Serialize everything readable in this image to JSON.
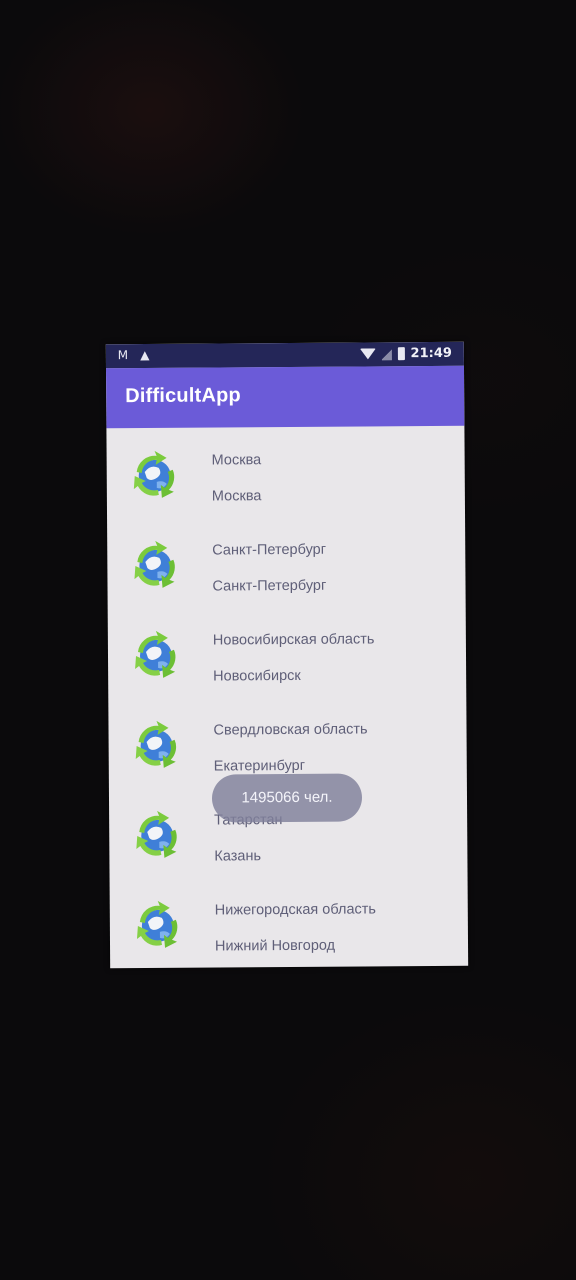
{
  "status_bar": {
    "left_icons": [
      "gmail-icon",
      "notification-icon"
    ],
    "time": "21:49"
  },
  "app_bar": {
    "title": "DifficultApp",
    "color": "#6b5bd8"
  },
  "items": [
    {
      "title": "Москва",
      "subtitle": "Москва",
      "icon": "recycle-globe-icon"
    },
    {
      "title": "Санкт-Петербург",
      "subtitle": "Санкт-Петербург",
      "icon": "recycle-globe-icon"
    },
    {
      "title": "Новосибирская область",
      "subtitle": "Новосибирск",
      "icon": "recycle-globe-icon"
    },
    {
      "title": "Свердловская область",
      "subtitle": "Екатеринбург",
      "icon": "recycle-globe-icon"
    },
    {
      "title": "Татарстан",
      "subtitle": "Казань",
      "icon": "recycle-globe-icon"
    },
    {
      "title": "Нижегородская область",
      "subtitle": "Нижний Новгород",
      "icon": "recycle-globe-icon"
    }
  ],
  "toast": {
    "text": "1495066 чел."
  }
}
